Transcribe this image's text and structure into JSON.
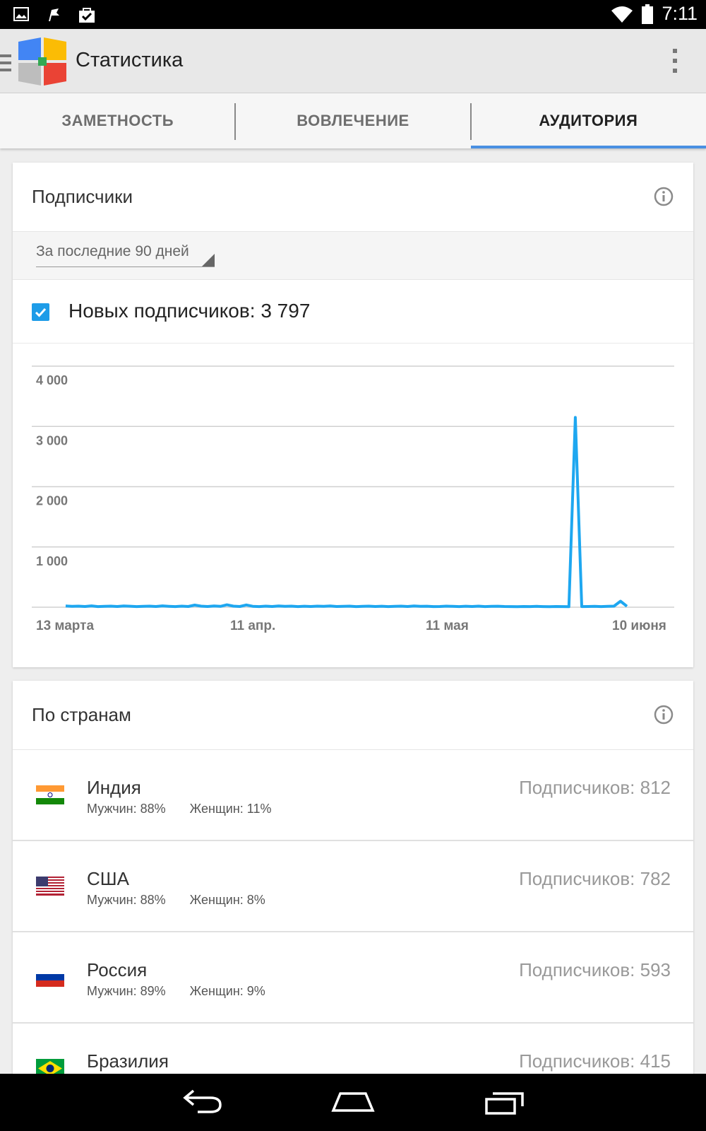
{
  "status_bar": {
    "time": "7:11",
    "icons": [
      "image-icon",
      "flag-icon",
      "shopping-bag-check-icon",
      "wifi-icon",
      "battery-icon"
    ]
  },
  "app_bar": {
    "title": "Статистика",
    "icons": [
      "menu-icon",
      "app-logo",
      "overflow-menu-icon"
    ]
  },
  "tabs": [
    {
      "label": "ЗАМЕТНОСТЬ",
      "active": false
    },
    {
      "label": "ВОВЛЕЧЕНИЕ",
      "active": false
    },
    {
      "label": "АУДИТОРИЯ",
      "active": true
    }
  ],
  "subscribers_card": {
    "title": "Подписчики",
    "period": "За последние 90 дней",
    "new_subscribers_label": "Новых подписчиков: 3 797",
    "checkbox_checked": true
  },
  "chart_data": {
    "type": "line",
    "y_ticks": [
      "4 000",
      "3 000",
      "2 000",
      "1 000"
    ],
    "x_ticks": [
      "13 марта",
      "11 апр.",
      "11 мая",
      "10 июня"
    ],
    "ylim": [
      0,
      4000
    ],
    "series_color": "#1ea7f0",
    "series": [
      {
        "values": [
          20,
          15,
          18,
          12,
          22,
          10,
          15,
          18,
          12,
          20,
          16,
          10,
          14,
          18,
          12,
          22,
          15,
          10,
          18,
          12,
          35,
          18,
          12,
          20,
          14,
          40,
          18,
          12,
          38,
          15,
          10,
          18,
          12,
          20,
          14,
          18,
          10,
          16,
          12,
          18,
          14,
          20,
          12,
          15,
          18,
          10,
          14,
          18,
          12,
          16,
          10,
          14,
          18,
          12,
          20,
          14,
          16,
          10,
          12,
          18,
          14,
          10,
          16,
          12,
          18,
          10,
          14,
          16,
          12,
          10,
          8,
          12,
          10,
          14,
          10,
          8,
          12,
          10,
          8,
          3150,
          10,
          12,
          15,
          10,
          14,
          18,
          100,
          15
        ]
      }
    ]
  },
  "countries_card": {
    "title": "По странам",
    "rows": [
      {
        "name": "Индия",
        "men": "Мужчин: 88%",
        "women": "Женщин: 11%",
        "subs": "Подписчиков: 812",
        "flag": "india-flag-icon"
      },
      {
        "name": "США",
        "men": "Мужчин: 88%",
        "women": "Женщин: 8%",
        "subs": "Подписчиков: 782",
        "flag": "usa-flag-icon"
      },
      {
        "name": "Россия",
        "men": "Мужчин: 89%",
        "women": "Женщин: 9%",
        "subs": "Подписчиков: 593",
        "flag": "russia-flag-icon"
      },
      {
        "name": "Бразилия",
        "men": "",
        "women": "",
        "subs": "Подписчиков: 415",
        "flag": "brazil-flag-icon"
      }
    ]
  },
  "nav_bar": {
    "icons": [
      "back-icon",
      "home-icon",
      "recents-icon"
    ]
  }
}
